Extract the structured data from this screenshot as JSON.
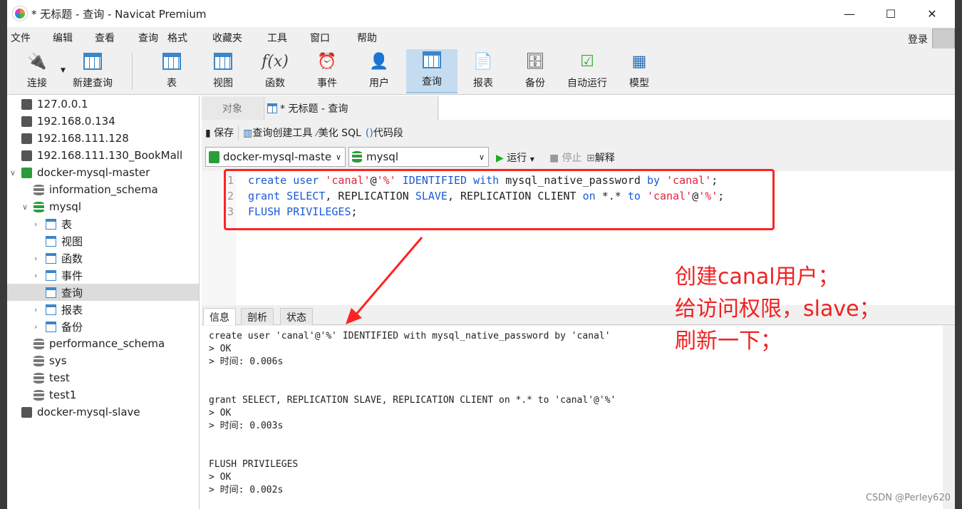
{
  "window": {
    "title": "* 无标题 - 查询 - Navicat Premium",
    "minimize": "—",
    "maximize": "☐",
    "close": "✕"
  },
  "menu": [
    "文件",
    "编辑",
    "查看",
    "查询",
    "格式",
    "收藏夹",
    "工具",
    "窗口",
    "帮助"
  ],
  "login": "登录",
  "toolbar": [
    {
      "label": "连接",
      "icon": "plug-icon"
    },
    {
      "label": "新建查询",
      "icon": "new-query-icon"
    },
    {
      "label": "表",
      "icon": "table-icon"
    },
    {
      "label": "视图",
      "icon": "view-icon"
    },
    {
      "label": "函数",
      "icon": "function-icon"
    },
    {
      "label": "事件",
      "icon": "clock-icon"
    },
    {
      "label": "用户",
      "icon": "user-icon"
    },
    {
      "label": "查询",
      "icon": "query-icon"
    },
    {
      "label": "报表",
      "icon": "report-icon"
    },
    {
      "label": "备份",
      "icon": "backup-icon"
    },
    {
      "label": "自动运行",
      "icon": "schedule-icon"
    },
    {
      "label": "模型",
      "icon": "model-icon"
    }
  ],
  "tree": [
    "127.0.0.1",
    "192.168.0.134",
    "192.168.111.128",
    "192.168.111.130_BookMall",
    "docker-mysql-master",
    "information_schema",
    "mysql",
    "表",
    "视图",
    "函数",
    "事件",
    "查询",
    "报表",
    "备份",
    "performance_schema",
    "sys",
    "test",
    "test1",
    "docker-mysql-slave"
  ],
  "tabs": {
    "objects": "对象",
    "query": "* 无标题 - 查询"
  },
  "query_toolbar": {
    "save": "保存",
    "builder": "查询创建工具",
    "beautify": "美化 SQL",
    "snippet": "代码段",
    "run": "运行",
    "stop": "停止",
    "explain": "解释"
  },
  "connection_select": "docker-mysql-maste",
  "database_select": "mysql",
  "result_tabs": [
    "信息",
    "剖析",
    "状态"
  ],
  "result_lines": [
    "create user 'canal'@'%' IDENTIFIED with mysql_native_password by 'canal'",
    "> OK",
    "> 时间: 0.006s",
    "",
    "",
    "grant SELECT, REPLICATION SLAVE, REPLICATION CLIENT on *.* to 'canal'@'%'",
    "> OK",
    "> 时间: 0.003s",
    "",
    "",
    "FLUSH PRIVILEGES",
    "> OK",
    "> 时间: 0.002s"
  ],
  "annotation": [
    "创建canal用户；",
    "给访问权限，slave；",
    "刷新一下；"
  ],
  "watermark": "CSDN @Perley620",
  "colors": {
    "annotation": "#f02222",
    "keyword": "#1a5ad6",
    "string": "#e0243c",
    "active_tool": "#c5dcf0"
  }
}
